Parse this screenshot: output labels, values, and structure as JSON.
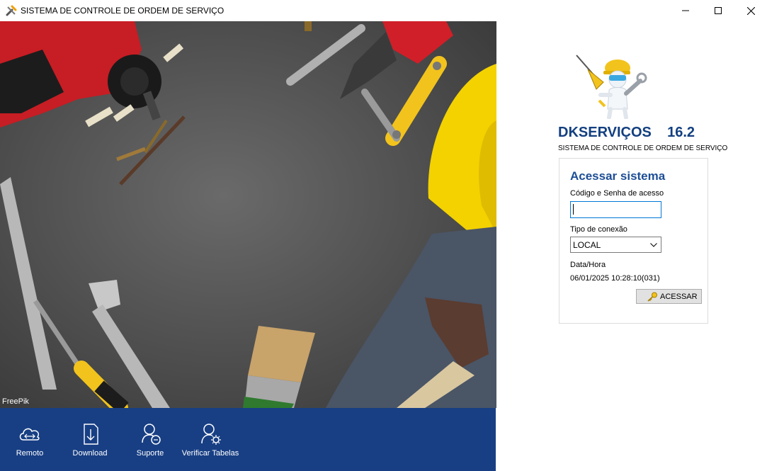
{
  "window": {
    "title": "SISTEMA DE CONTROLE DE ORDEM DE SERVIÇO",
    "app_icon": "tools-icon",
    "controls": [
      "minimize-icon",
      "maximize-icon",
      "close-icon"
    ]
  },
  "hero": {
    "credit": "FreePik"
  },
  "toolbar": {
    "items": [
      {
        "label": "Remoto",
        "icon": "cloud-sync-icon"
      },
      {
        "label": "Download",
        "icon": "download-icon"
      },
      {
        "label": "Suporte",
        "icon": "support-icon"
      },
      {
        "label": "Verificar Tabelas",
        "icon": "user-settings-icon"
      }
    ]
  },
  "brand": {
    "name": "DKSERVIÇOS",
    "version": "16.2",
    "subtitle": "SISTEMA DE CONTROLE DE ORDEM DE SERVIÇO"
  },
  "login": {
    "title": "Acessar sistema",
    "code_label": "Código e Senha de acesso",
    "code_value": "",
    "connection_label": "Tipo de conexão",
    "connection_value": "LOCAL",
    "datetime_label": "Data/Hora",
    "datetime_value": "06/01/2025 10:28:10(031)",
    "submit_label": "ACESSAR",
    "submit_icon": "key-icon"
  },
  "colors": {
    "toolbar_bg": "#183f84",
    "brand_text": "#123f80",
    "panel_title": "#1e4e96",
    "input_focus": "#0078d7"
  }
}
